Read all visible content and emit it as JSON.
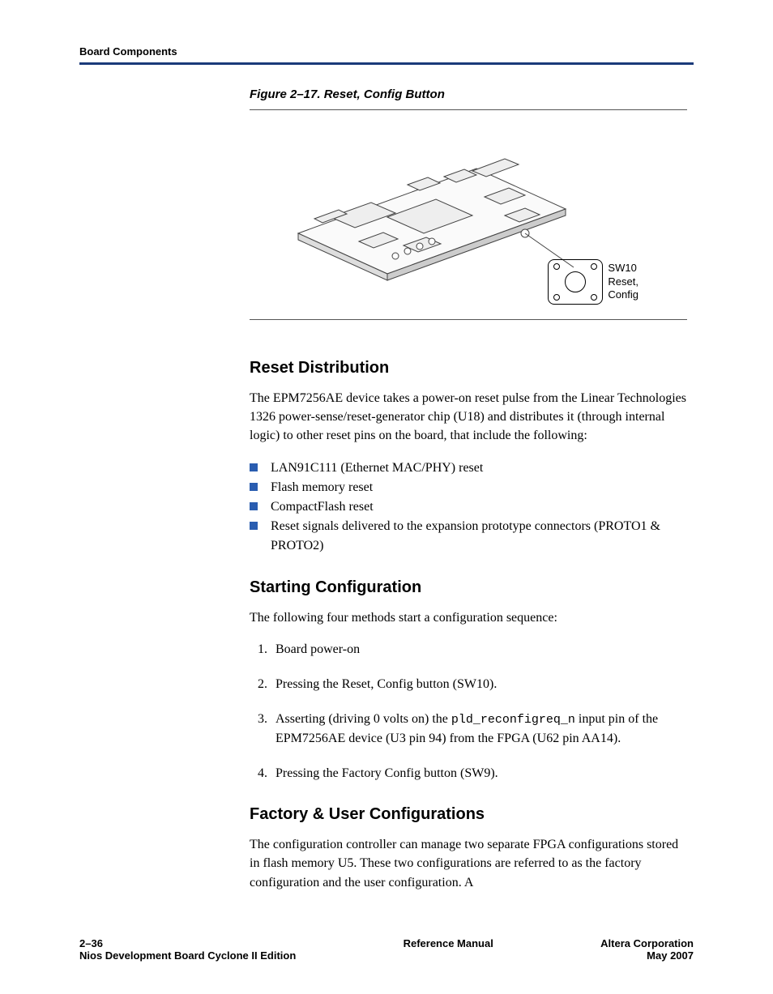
{
  "header": {
    "section": "Board Components"
  },
  "figure": {
    "caption": "Figure 2–17. Reset, Config Button",
    "callout": {
      "designator": "SW10",
      "label_line1": "Reset,",
      "label_line2": "Config"
    }
  },
  "sections": {
    "reset_dist": {
      "title": "Reset Distribution",
      "para": "The EPM7256AE device takes a power-on reset pulse from the Linear Technologies 1326 power-sense/reset-generator chip (U18) and distributes it (through internal logic) to other reset pins on the board, that include the following:",
      "items": [
        "LAN91C111 (Ethernet MAC/PHY) reset",
        "Flash memory reset",
        "CompactFlash reset",
        "Reset signals delivered to the expansion prototype connectors (PROTO1 & PROTO2)"
      ]
    },
    "starting_config": {
      "title": "Starting Configuration",
      "para": "The following four methods start a configuration sequence:",
      "items": {
        "i1": "Board power-on",
        "i2": "Pressing the Reset, Config button (SW10).",
        "i3_pre": "Asserting (driving 0 volts on) the ",
        "i3_code": "pld_reconfigreq_n",
        "i3_post": " input pin of the EPM7256AE device (U3 pin 94) from the FPGA (U62 pin AA14).",
        "i4": "Pressing the Factory Config button (SW9)."
      }
    },
    "factory_user": {
      "title": "Factory & User Configurations",
      "para": "The configuration controller can manage two separate FPGA configurations stored in flash memory U5. These two configurations are referred to as the factory configuration and the user configuration. A"
    }
  },
  "footer": {
    "page": "2–36",
    "doc_line2": "Nios Development Board Cyclone II Edition",
    "center": "Reference Manual",
    "company": "Altera Corporation",
    "date": "May 2007"
  }
}
